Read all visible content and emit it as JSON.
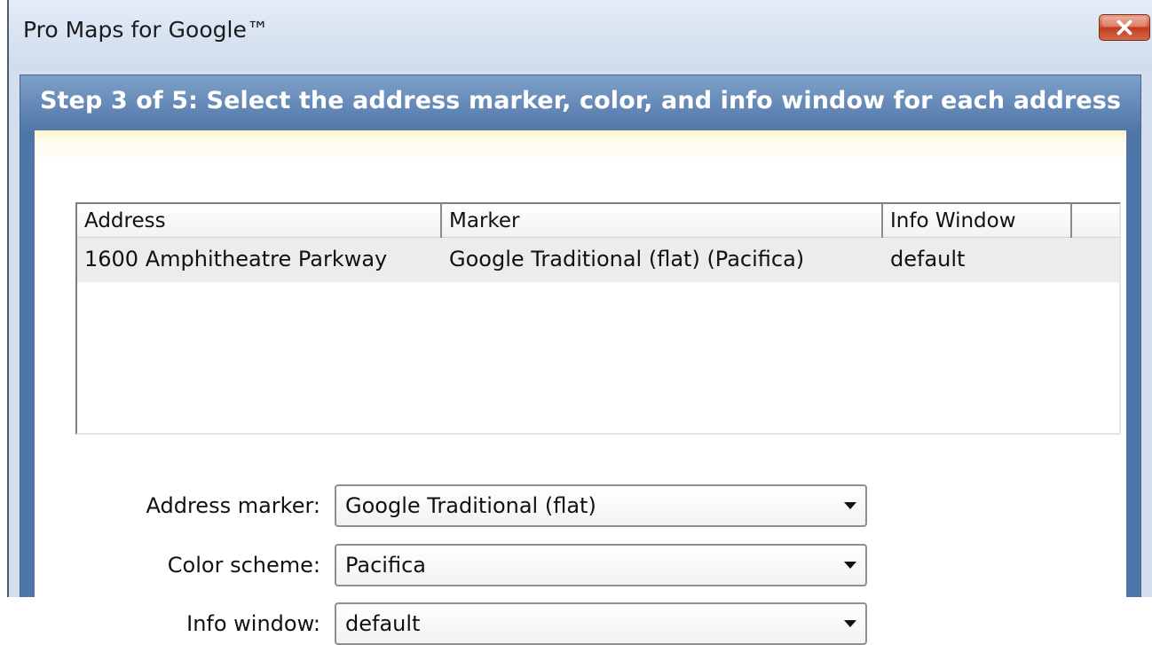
{
  "window": {
    "title": "Pro Maps for Google™",
    "close_icon": "close-icon"
  },
  "step": {
    "title": "Step 3 of 5: Select the address marker, color, and info window for each address"
  },
  "address_list": {
    "columns": [
      "Address",
      "Marker",
      "Info Window"
    ],
    "rows": [
      {
        "address": "1600 Amphitheatre Parkway",
        "marker": "Google Traditional (flat) (Pacifica)",
        "info_window": "default"
      }
    ]
  },
  "form": {
    "address_marker": {
      "label": "Address marker:",
      "value": "Google Traditional (flat)"
    },
    "color_scheme": {
      "label": "Color scheme:",
      "value": "Pacifica"
    },
    "info_window": {
      "label": "Info window:",
      "value": "default"
    }
  },
  "colors": {
    "step_header": "#4f76a8",
    "close_button": "#c94a2a",
    "selected_row": "#ececec"
  }
}
